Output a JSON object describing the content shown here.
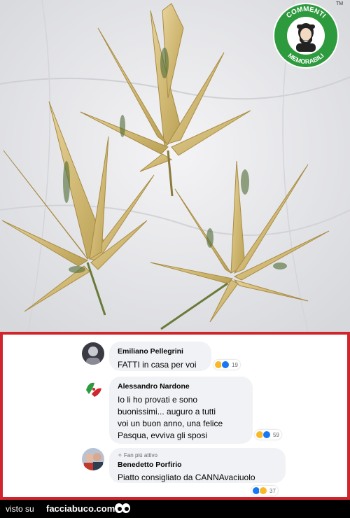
{
  "logo": {
    "top_text": "COMMENTI",
    "bottom_text": "MEMORABILI",
    "tm": "TM"
  },
  "comments": [
    {
      "author": "Emiliano Pellegrini",
      "text": "FATTI in casa per voi",
      "reactions": [
        "haha-icon",
        "like-icon"
      ],
      "count": "19"
    },
    {
      "author": "Alessandro Nardone",
      "text": "Io li ho provati e sono\nbuonissimi... auguro a tutti\nvoi un buon anno, una felice\nPasqua, evviva gli sposi",
      "reactions": [
        "haha-icon",
        "like-icon"
      ],
      "count": "59"
    },
    {
      "badge": "Fan più attivo",
      "author": "Benedetto Porfirio",
      "text": "Piatto consigliato da CANNAvaciuolo",
      "reactions": [
        "like-icon",
        "haha-icon"
      ],
      "count": "37"
    }
  ],
  "footer": {
    "visto": "visto su",
    "site": "facciabuco.com"
  },
  "colors": {
    "frame": "#d0252c",
    "bubble": "#f0f2f5",
    "haha": "#f7b928",
    "like": "#1877f2",
    "logo_green": "#2e9a3e"
  }
}
